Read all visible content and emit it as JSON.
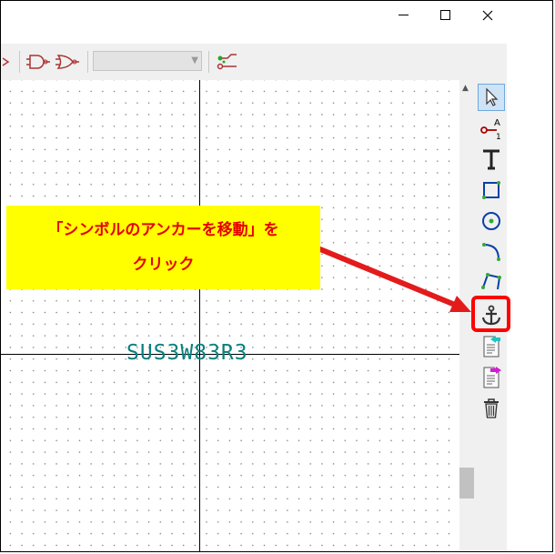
{
  "window": {
    "controls": {
      "minimize": "—",
      "maximize": "☐",
      "close": "✕"
    }
  },
  "toolbar": {
    "icons": [
      "partial-icon",
      "and-gate-icon",
      "or-gate-icon",
      "unit-select-combo",
      "pin-to-label-icon"
    ],
    "unit_select_value": ""
  },
  "canvas": {
    "reference_text": "SUS3W83R3",
    "reference_color": "#0a7f7f"
  },
  "right_toolbar": {
    "tools": [
      "select-arrow-icon",
      "pin-icon",
      "text-icon",
      "rectangle-icon",
      "circle-icon",
      "arc-icon",
      "polyline-icon",
      "anchor-icon",
      "import-icon",
      "export-icon",
      "delete-icon"
    ],
    "highlighted_tool": "anchor-icon",
    "highlight_color": "#ff0000"
  },
  "annotation": {
    "line1": "「シンボルのアンカーを移動」を",
    "line2": "クリック",
    "background": "#ffff00",
    "text_color": "#e60000",
    "arrow_color": "#e31b1b"
  }
}
